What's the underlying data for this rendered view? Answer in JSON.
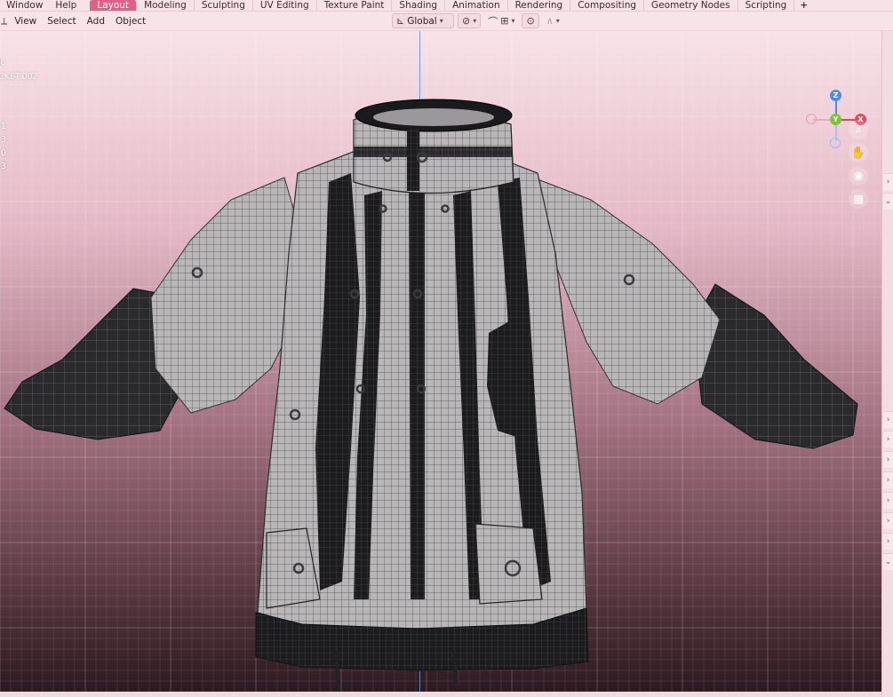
{
  "topbar": {
    "menu": [
      "Window",
      "Help"
    ],
    "tabs": [
      "Layout",
      "Modeling",
      "Sculpting",
      "UV Editing",
      "Texture Paint",
      "Shading",
      "Animation",
      "Rendering",
      "Compositing",
      "Geometry Nodes",
      "Scripting"
    ],
    "active_tab": "Layout",
    "add_tab": "+"
  },
  "viewport_header": {
    "menu": [
      "View",
      "Select",
      "Add",
      "Object"
    ],
    "transform_orientation": "Global"
  },
  "overlay": {
    "mode_partial": "ic",
    "object_name_partial": "CKET.002",
    "stats": [
      "1",
      "3",
      "0",
      "3"
    ]
  },
  "gizmo": {
    "x": "X",
    "y": "Y",
    "z": "Z"
  },
  "icons": {
    "zoom": "zoom-icon",
    "pan": "hand-icon",
    "camera": "camera-icon",
    "ortho": "grid-icon"
  },
  "colors": {
    "active_tab": "#e0608a",
    "axis_x": "#e24a5e",
    "axis_y": "#7bc43c",
    "axis_z": "#4f8be8"
  }
}
